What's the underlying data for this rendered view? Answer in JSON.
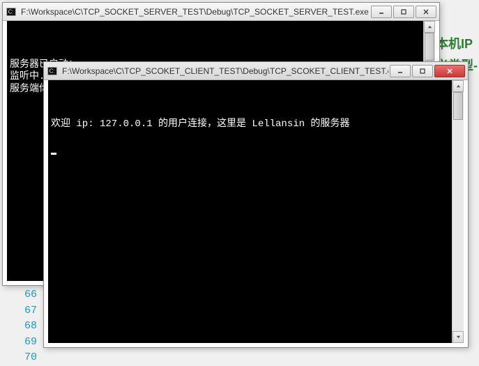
{
  "background": {
    "side_text_line1": "本机IP",
    "side_text_line2": "义类型‐",
    "line_numbers": [
      "66",
      "67",
      "68",
      "69",
      "70"
    ]
  },
  "server_window": {
    "title": "F:\\Workspace\\C\\TCP_SOCKET_SERVER_TEST\\Debug\\TCP_SOCKET_SERVER_TEST.exe",
    "lines": [
      "服务器已启动：",
      "监听中...",
      "服务端你好~"
    ]
  },
  "client_window": {
    "title": "F:\\Workspace\\C\\TCP_SCOKET_CLIENT_TEST\\Debug\\TCP_SCOKET_CLIENT_TEST.exe",
    "lines": [
      "欢迎 ip: 127.0.0.1 的用户连接，这里是 Lellansin 的服务器"
    ]
  },
  "controls": {
    "minimize": "minimize",
    "maximize": "maximize",
    "close": "close"
  }
}
